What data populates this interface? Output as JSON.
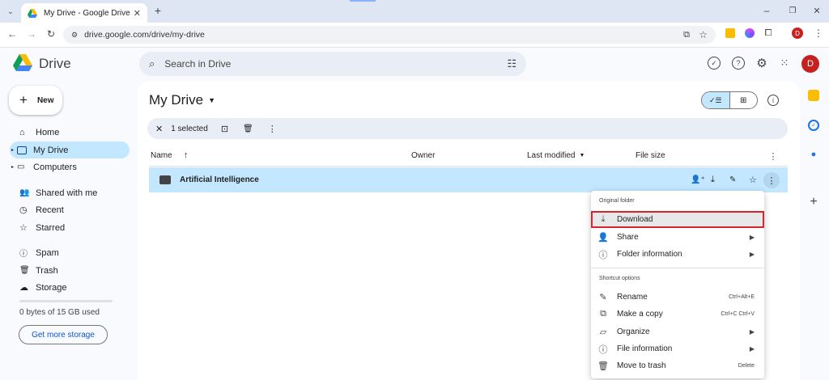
{
  "browser": {
    "tab_title": "My Drive - Google Drive",
    "url": "drive.google.com/drive/my-drive",
    "profile_initial": "D"
  },
  "app": {
    "name": "Drive",
    "search_placeholder": "Search in Drive",
    "avatar_initial": "D"
  },
  "sidebar": {
    "new_label": "New",
    "items": [
      {
        "label": "Home",
        "icon": "home-icon"
      },
      {
        "label": "My Drive",
        "icon": "drive-icon",
        "active": true
      },
      {
        "label": "Computers",
        "icon": "computer-icon"
      },
      {
        "label": "Shared with me",
        "icon": "people-icon"
      },
      {
        "label": "Recent",
        "icon": "clock-icon"
      },
      {
        "label": "Starred",
        "icon": "star-icon"
      },
      {
        "label": "Spam",
        "icon": "spam-icon"
      },
      {
        "label": "Trash",
        "icon": "trash-icon"
      },
      {
        "label": "Storage",
        "icon": "cloud-icon"
      }
    ],
    "storage_text": "0 bytes of 15 GB used",
    "storage_fraction": 0,
    "get_storage_label": "Get more storage"
  },
  "main": {
    "title": "My Drive",
    "selection_text": "1 selected",
    "columns": {
      "name": "Name",
      "owner": "Owner",
      "modified": "Last modified",
      "size": "File size"
    },
    "rows": [
      {
        "name": "Artificial Intelligence"
      }
    ]
  },
  "context_menu": {
    "section1_header": "Original folder",
    "download": "Download",
    "share": "Share",
    "folder_info": "Folder information",
    "section2_header": "Shortcut options",
    "rename": "Rename",
    "rename_shortcut": "Ctrl+Alt+E",
    "copy": "Make a copy",
    "copy_shortcut": "Ctrl+C Ctrl+V",
    "organize": "Organize",
    "file_info": "File information",
    "trash": "Move to trash",
    "trash_shortcut": "Delete"
  },
  "colors": {
    "accent": "#0b57d0",
    "selected": "#c2e7ff",
    "highlight_border": "#d9232e"
  }
}
